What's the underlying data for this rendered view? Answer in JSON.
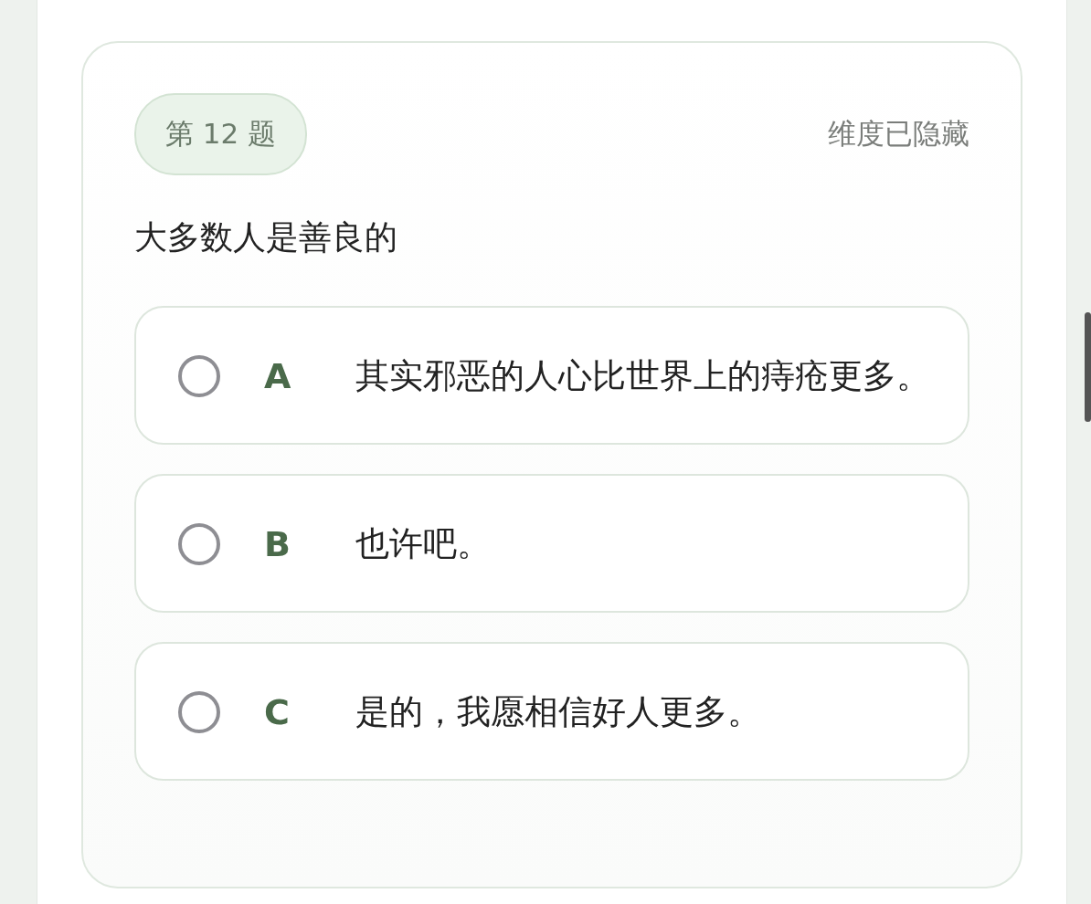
{
  "question": {
    "number_badge": "第 12 题",
    "dimension_note": "维度已隐藏",
    "text": "大多数人是善良的",
    "options": [
      {
        "letter": "A",
        "text": "其实邪恶的人心比世界上的痔疮更多。",
        "selected": false
      },
      {
        "letter": "B",
        "text": "也许吧。",
        "selected": false
      },
      {
        "letter": "C",
        "text": "是的，我愿相信好人更多。",
        "selected": false
      }
    ]
  }
}
